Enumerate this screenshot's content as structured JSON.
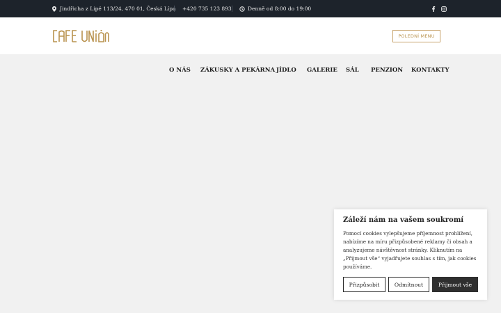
{
  "topbar": {
    "address": "Jindřicha z Lipé 113/24, 470 01, Česká Lípa",
    "phone": "+420 735 123 893",
    "hours": "Denně od 8:00 do 19:00",
    "icons": [
      "map-pin-icon",
      "phone-icon",
      "clock-icon",
      "facebook-icon",
      "instagram-icon"
    ]
  },
  "header": {
    "logo": "CAFE UNION",
    "menu_button": "POLEDNÍ MENU",
    "accent": "#b9934f"
  },
  "nav": {
    "items": [
      "O NÁS",
      "ZÁKUSKY A PEKÁRNA",
      "JÍDLO",
      "GALERIE",
      "SÁL",
      "PENZION",
      "KONTAKTY"
    ]
  },
  "cookie": {
    "title": "Záleží nám na vašem soukromí",
    "text": "Pomocí cookies vylepšujeme příjemnost prohlížení, nabízíme na míru přizpůsobené reklamy či obsah a analyzujeme návštěvnost stránky. Kliknutím na „Přijmout vše“ vyjadřujete souhlas s tím, jak cookies používáme.",
    "customize": "Přizpůsobit",
    "reject": "Odmítnout",
    "accept": "Přijmout vše"
  }
}
